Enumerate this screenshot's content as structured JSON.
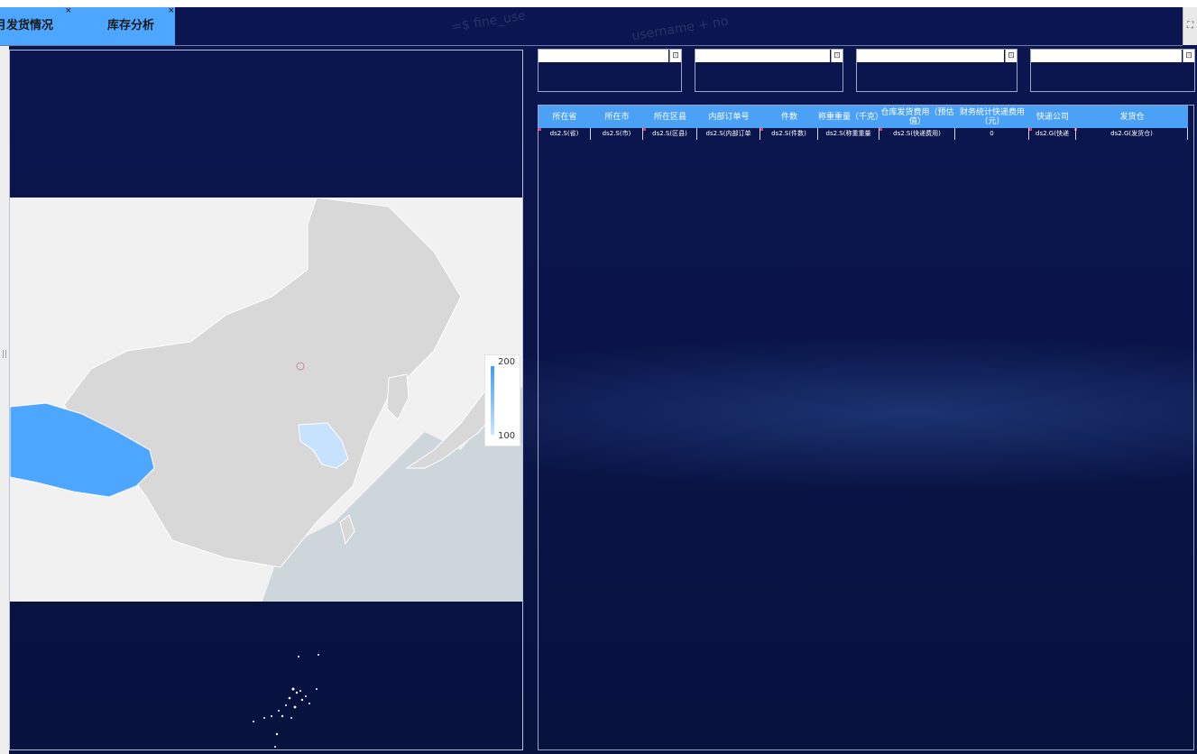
{
  "tabs": [
    {
      "label": "月发货情况",
      "close": "×"
    },
    {
      "label": "库存分析",
      "close": "×"
    }
  ],
  "watermark": {
    "text1": "=$ fine_use",
    "text2": "username + no"
  },
  "fullscreen_icon": "⛶",
  "map": {
    "legend_max": "200",
    "legend_min": "100",
    "colors": {
      "xizang": "#4da6ff",
      "jiangsu": "#c6e2ff",
      "land": "#d8d8d8",
      "sea": "#cdd6da"
    }
  },
  "filters": [
    {
      "value": "",
      "btn": "⊡"
    },
    {
      "value": "",
      "btn": "⊡"
    },
    {
      "value": "",
      "btn": "⊡"
    },
    {
      "value": "",
      "btn": "⊡"
    }
  ],
  "table": {
    "headers": [
      "所在省",
      "所在市",
      "所在区县",
      "内部订单号",
      "件数",
      "称重重量（千克）",
      "仓库发货费用（预估值）",
      "财务统计快递费用（元）",
      "快递公司",
      "发货仓"
    ],
    "row": [
      "ds2.S(省)",
      "ds2.S(市)",
      "ds2.S(区县)",
      "ds2.S(内部订单",
      "ds2.S(件数)",
      "ds2.S(称重重量",
      "ds2.S(快递费用)",
      "0",
      "ds2.G(快递",
      "ds2.G(发货仓)"
    ]
  }
}
